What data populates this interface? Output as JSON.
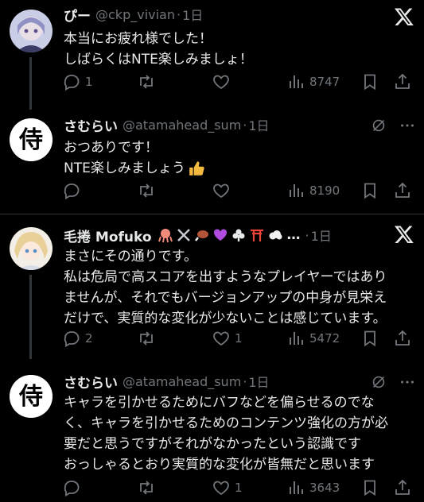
{
  "posts": [
    {
      "name": "ぴー",
      "handle": "@ckp_vivian",
      "dot": "·",
      "time": "1日",
      "lines": [
        "本当にお疲れ様でした！",
        "しばらくはNTE楽しみましょ！"
      ],
      "replies": "1",
      "retweets": "",
      "likes": "",
      "views": "8747"
    },
    {
      "name": "さむらい",
      "handle": "@atamahead_sum",
      "dot": "·",
      "time": "1日",
      "lines": [
        "おつありです！",
        "NTE楽しみましょう"
      ],
      "replies": "",
      "retweets": "",
      "likes": "",
      "views": "8190",
      "avatar_char": "侍"
    },
    {
      "name": "毛捲 Mofuko",
      "name_ellipsis": "…",
      "dot": "·",
      "time": "1日",
      "lines": [
        "まさにその通りです。",
        "私は危局で高スコアを出すようなプレイヤーではあり",
        "ませんが、それでもバージョンアップの中身が見栄え",
        "だけで、実質的な変化が少ないことは感じています。"
      ],
      "replies": "2",
      "retweets": "",
      "likes": "1",
      "views": "5472"
    },
    {
      "name": "さむらい",
      "handle": "@atamahead_sum",
      "dot": "·",
      "time": "1日",
      "lines": [
        "キャラを引かせるためにバフなどを偏らせるのでな",
        "く、キャラを引かせるためのコンテンツ強化の方が必",
        "要だと思うですがそれがなかったという認識です",
        "おっしゃるとおり実質的な変化が皆無だと思います"
      ],
      "replies": "",
      "retweets": "",
      "likes": "1",
      "views": "3643",
      "avatar_char": "侍"
    }
  ],
  "icons": {
    "reply": "reply-icon",
    "retweet": "retweet-icon",
    "like": "heart-icon",
    "views": "views-icon",
    "bookmark": "bookmark-icon",
    "share": "share-icon",
    "more": "more-icon",
    "x": "x-logo-icon",
    "grok": "grok-icon"
  },
  "colors": {
    "background": "#000000",
    "text": "#e7e9ea",
    "muted": "#71767b",
    "divider": "#2f3336"
  }
}
